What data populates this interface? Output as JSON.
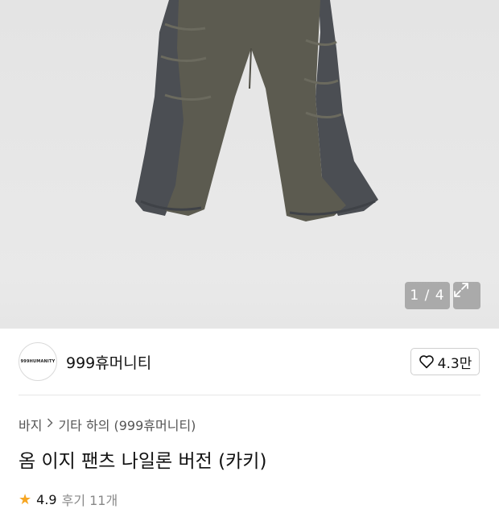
{
  "gallery": {
    "counter": "1 / 4",
    "expand_icon": "expand-icon",
    "image_alt": "khaki nylon wide pants"
  },
  "brand": {
    "logo_text": "999HUMANITY",
    "name": "999휴머니티",
    "like_icon": "heart-icon",
    "like_count": "4.3만"
  },
  "breadcrumb": {
    "items": [
      "바지",
      "기타 하의 (999휴머니티)"
    ],
    "separator_icon": "chevron-right-icon"
  },
  "product": {
    "title": "옴 이지 팬츠 나일론 버전 (카키)"
  },
  "rating": {
    "star_icon": "star-icon",
    "score": "4.9",
    "reviews": "후기 11개"
  },
  "colors": {
    "pants_main": "#5b5a4f",
    "pants_side": "#4a4d52",
    "star": "#f6a623"
  }
}
